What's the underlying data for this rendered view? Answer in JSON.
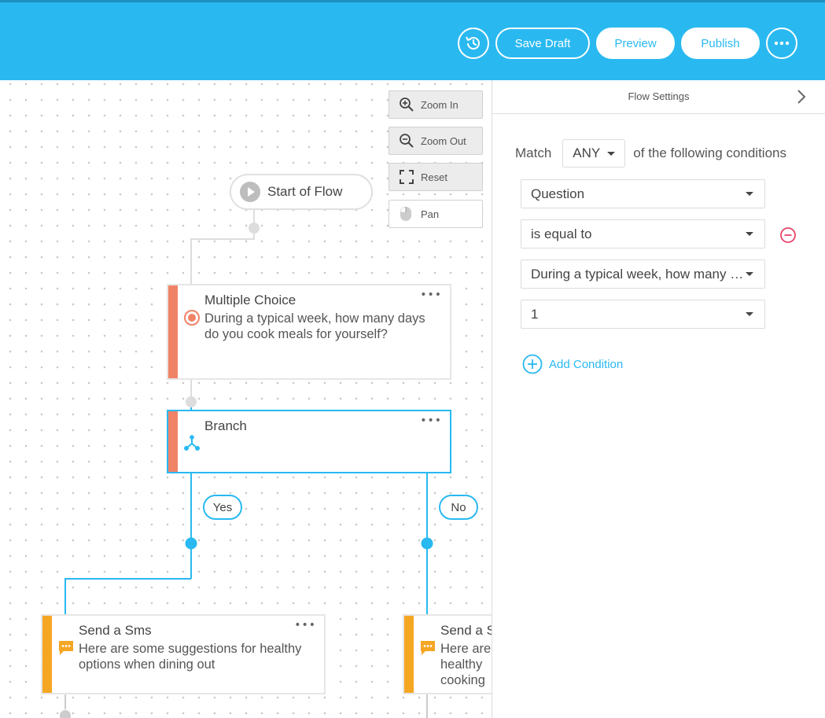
{
  "header": {
    "history_icon": "history-icon",
    "save_draft": "Save Draft",
    "preview": "Preview",
    "publish": "Publish",
    "more_icon": "more-horizontal-icon"
  },
  "canvas": {
    "zoom_in": "Zoom In",
    "zoom_out": "Zoom Out",
    "reset": "Reset",
    "pan": "Pan",
    "start": "Start of Flow",
    "nodes": {
      "multiple_choice": {
        "title": "Multiple Choice",
        "body": "During a typical week, how many days do you cook meals for yourself?",
        "menu": "•••"
      },
      "branch": {
        "title": "Branch",
        "menu": "•••"
      },
      "sms_yes": {
        "title": "Send a Sms",
        "body": "Here are some suggestions for healthy options when dining out",
        "menu": "•••"
      },
      "sms_no": {
        "title": "Send a S",
        "body_lines": [
          "Here are",
          "healthy",
          "cooking"
        ]
      }
    },
    "branch_labels": {
      "yes": "Yes",
      "no": "No"
    },
    "colors": {
      "accent": "#29b9f0",
      "multiple_choice": "#f08366",
      "branch": "#f08366",
      "sms": "#f5a623"
    }
  },
  "panel": {
    "title": "Flow Settings",
    "match_label": "Match",
    "match_value": "ANY",
    "match_suffix": "of the following conditions",
    "conditions": [
      "Question",
      "is equal to",
      "During a typical week, how many days do you cook meals for yourself?",
      "1"
    ],
    "add_condition": "Add Condition",
    "remove_color": "#e8456b"
  }
}
